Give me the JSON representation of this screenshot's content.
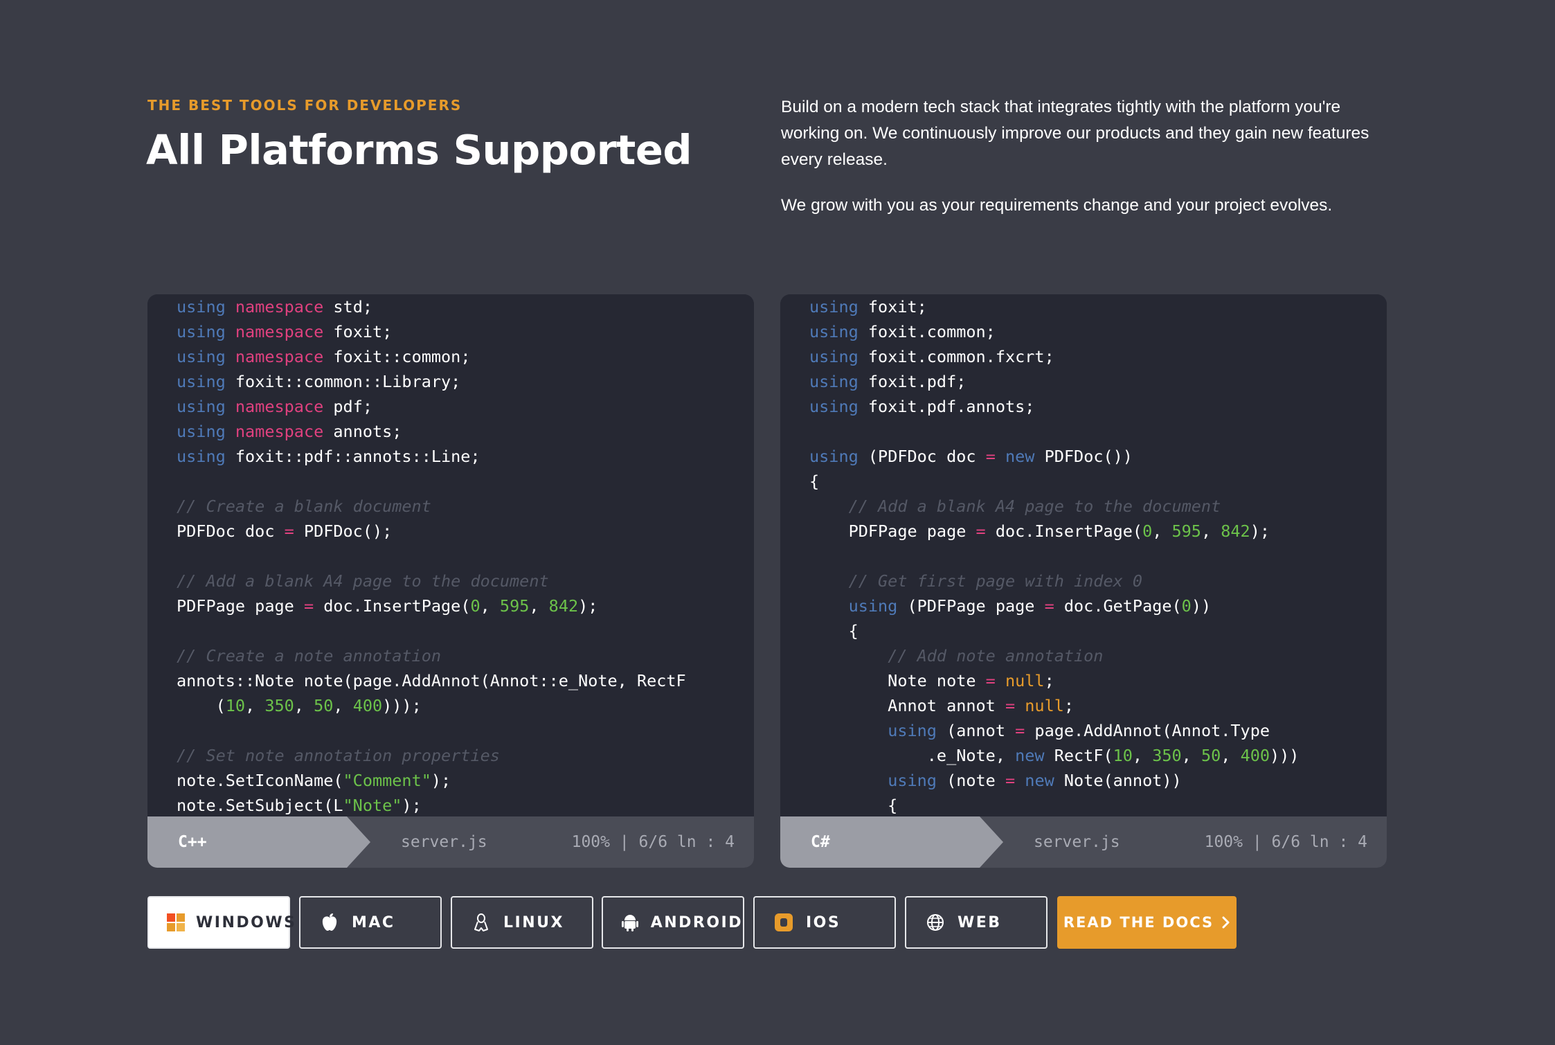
{
  "header": {
    "eyebrow": "THE BEST TOOLS FOR DEVELOPERS",
    "title": "All Platforms Supported"
  },
  "intro": {
    "paragraph1": "Build on a modern tech stack that integrates tightly with the platform you're working on. We continuously improve our products and they gain new features every release.",
    "paragraph2": "We grow with you as your requirements change and your project evolves."
  },
  "editors": [
    {
      "language": "C++",
      "filename": "server.js",
      "position": "100% | 6/6 ln : 4",
      "lines": [
        [
          [
            "kw",
            "using"
          ],
          [
            "t",
            " "
          ],
          [
            "ns",
            "namespace"
          ],
          [
            "t",
            " std;"
          ]
        ],
        [
          [
            "kw",
            "using"
          ],
          [
            "t",
            " "
          ],
          [
            "ns",
            "namespace"
          ],
          [
            "t",
            " foxit;"
          ]
        ],
        [
          [
            "kw",
            "using"
          ],
          [
            "t",
            " "
          ],
          [
            "ns",
            "namespace"
          ],
          [
            "t",
            " foxit::common;"
          ]
        ],
        [
          [
            "kw",
            "using"
          ],
          [
            "t",
            " foxit::common::Library;"
          ]
        ],
        [
          [
            "kw",
            "using"
          ],
          [
            "t",
            " "
          ],
          [
            "ns",
            "namespace"
          ],
          [
            "t",
            " pdf;"
          ]
        ],
        [
          [
            "kw",
            "using"
          ],
          [
            "t",
            " "
          ],
          [
            "ns",
            "namespace"
          ],
          [
            "t",
            " annots;"
          ]
        ],
        [
          [
            "kw",
            "using"
          ],
          [
            "t",
            " foxit::pdf::annots::Line;"
          ]
        ],
        [],
        [
          [
            "cm",
            "// Create a blank document"
          ]
        ],
        [
          [
            "t",
            "PDFDoc doc "
          ],
          [
            "op",
            "="
          ],
          [
            "t",
            " PDFDoc();"
          ]
        ],
        [],
        [
          [
            "cm",
            "// Add a blank A4 page to the document"
          ]
        ],
        [
          [
            "t",
            "PDFPage page "
          ],
          [
            "op",
            "="
          ],
          [
            "t",
            " doc.InsertPage("
          ],
          [
            "num",
            "0"
          ],
          [
            "t",
            ", "
          ],
          [
            "num",
            "595"
          ],
          [
            "t",
            ", "
          ],
          [
            "num",
            "842"
          ],
          [
            "t",
            ");"
          ]
        ],
        [],
        [
          [
            "cm",
            "// Create a note annotation"
          ]
        ],
        [
          [
            "t",
            "annots::Note note(page.AddAnnot(Annot::e_Note, RectF"
          ]
        ],
        [
          [
            "t",
            "    ("
          ],
          [
            "num",
            "10"
          ],
          [
            "t",
            ", "
          ],
          [
            "num",
            "350"
          ],
          [
            "t",
            ", "
          ],
          [
            "num",
            "50"
          ],
          [
            "t",
            ", "
          ],
          [
            "num",
            "400"
          ],
          [
            "t",
            ")));"
          ]
        ],
        [],
        [
          [
            "cm",
            "// Set note annotation properties"
          ]
        ],
        [
          [
            "t",
            "note.SetIconName("
          ],
          [
            "str",
            "\"Comment\""
          ],
          [
            "t",
            ");"
          ]
        ],
        [
          [
            "t",
            "note.SetSubject(L"
          ],
          [
            "str",
            "\"Note\""
          ],
          [
            "t",
            ");"
          ]
        ]
      ]
    },
    {
      "language": "C#",
      "filename": "server.js",
      "position": "100% | 6/6 ln : 4",
      "lines": [
        [
          [
            "kw",
            "using"
          ],
          [
            "t",
            " foxit;"
          ]
        ],
        [
          [
            "kw",
            "using"
          ],
          [
            "t",
            " foxit.common;"
          ]
        ],
        [
          [
            "kw",
            "using"
          ],
          [
            "t",
            " foxit.common.fxcrt;"
          ]
        ],
        [
          [
            "kw",
            "using"
          ],
          [
            "t",
            " foxit.pdf;"
          ]
        ],
        [
          [
            "kw",
            "using"
          ],
          [
            "t",
            " foxit.pdf.annots;"
          ]
        ],
        [],
        [
          [
            "kw",
            "using"
          ],
          [
            "t",
            " (PDFDoc doc "
          ],
          [
            "op",
            "="
          ],
          [
            "t",
            " "
          ],
          [
            "kw",
            "new"
          ],
          [
            "t",
            " PDFDoc())"
          ]
        ],
        [
          [
            "t",
            "{"
          ]
        ],
        [
          [
            "t",
            "    "
          ],
          [
            "cm",
            "// Add a blank A4 page to the document"
          ]
        ],
        [
          [
            "t",
            "    PDFPage page "
          ],
          [
            "op",
            "="
          ],
          [
            "t",
            " doc.InsertPage("
          ],
          [
            "num",
            "0"
          ],
          [
            "t",
            ", "
          ],
          [
            "num",
            "595"
          ],
          [
            "t",
            ", "
          ],
          [
            "num",
            "842"
          ],
          [
            "t",
            ");"
          ]
        ],
        [],
        [
          [
            "t",
            "    "
          ],
          [
            "cm",
            "// Get first page with index 0"
          ]
        ],
        [
          [
            "t",
            "    "
          ],
          [
            "kw",
            "using"
          ],
          [
            "t",
            " (PDFPage page "
          ],
          [
            "op",
            "="
          ],
          [
            "t",
            " doc.GetPage("
          ],
          [
            "num",
            "0"
          ],
          [
            "t",
            "))"
          ]
        ],
        [
          [
            "t",
            "    {"
          ]
        ],
        [
          [
            "t",
            "        "
          ],
          [
            "cm",
            "// Add note annotation"
          ]
        ],
        [
          [
            "t",
            "        Note note "
          ],
          [
            "op",
            "="
          ],
          [
            "t",
            " "
          ],
          [
            "nul",
            "null"
          ],
          [
            "t",
            ";"
          ]
        ],
        [
          [
            "t",
            "        Annot annot "
          ],
          [
            "op",
            "="
          ],
          [
            "t",
            " "
          ],
          [
            "nul",
            "null"
          ],
          [
            "t",
            ";"
          ]
        ],
        [
          [
            "t",
            "        "
          ],
          [
            "kw",
            "using"
          ],
          [
            "t",
            " (annot "
          ],
          [
            "op",
            "="
          ],
          [
            "t",
            " page.AddAnnot(Annot.Type"
          ]
        ],
        [
          [
            "t",
            "            .e_Note, "
          ],
          [
            "kw",
            "new"
          ],
          [
            "t",
            " RectF("
          ],
          [
            "num",
            "10"
          ],
          [
            "t",
            ", "
          ],
          [
            "num",
            "350"
          ],
          [
            "t",
            ", "
          ],
          [
            "num",
            "50"
          ],
          [
            "t",
            ", "
          ],
          [
            "num",
            "400"
          ],
          [
            "t",
            ")))"
          ]
        ],
        [
          [
            "t",
            "        "
          ],
          [
            "kw",
            "using"
          ],
          [
            "t",
            " (note "
          ],
          [
            "op",
            "="
          ],
          [
            "t",
            " "
          ],
          [
            "kw",
            "new"
          ],
          [
            "t",
            " Note(annot))"
          ]
        ],
        [
          [
            "t",
            "        {"
          ]
        ]
      ]
    }
  ],
  "token_colors": {
    "kw": "#4f7ab8",
    "ns": "#e0417f",
    "t": "#ffffff",
    "cm": "#555966",
    "op": "#e0417f",
    "num": "#6cc24a",
    "str": "#6cc24a",
    "nul": "#e79b2b"
  },
  "platforms": [
    {
      "label": "WINDOWS",
      "icon": "windows-icon",
      "active": true
    },
    {
      "label": "MAC",
      "icon": "apple-icon",
      "active": false
    },
    {
      "label": "LINUX",
      "icon": "linux-icon",
      "active": false
    },
    {
      "label": "ANDROID",
      "icon": "android-icon",
      "active": false
    },
    {
      "label": "IOS",
      "icon": "ios-icon",
      "active": false
    },
    {
      "label": "WEB",
      "icon": "globe-icon",
      "active": false
    }
  ],
  "cta": {
    "label": "READ THE DOCS",
    "icon": "chevron-right-icon"
  },
  "colors": {
    "background": "#3a3c46",
    "accent": "#e79b2b",
    "editor_bg": "#262833"
  }
}
